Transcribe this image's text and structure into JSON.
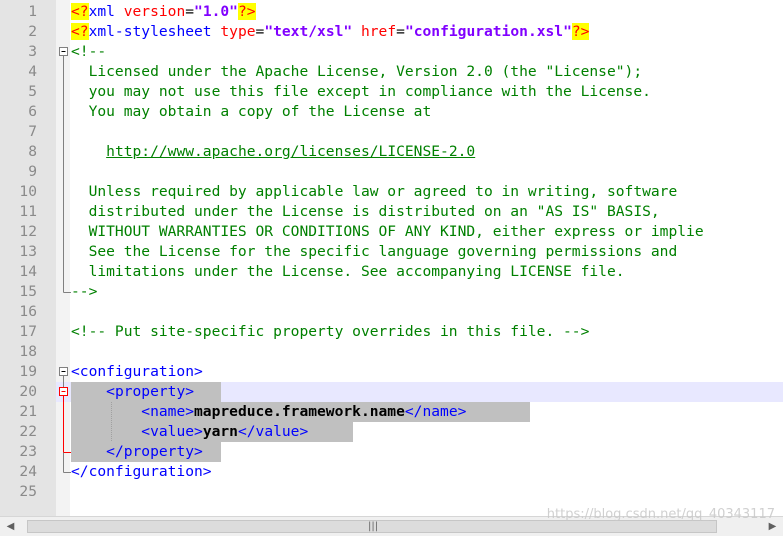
{
  "editor": {
    "line_numbers": [
      "1",
      "2",
      "3",
      "4",
      "5",
      "6",
      "7",
      "8",
      "9",
      "10",
      "11",
      "12",
      "13",
      "14",
      "15",
      "16",
      "17",
      "18",
      "19",
      "20",
      "21",
      "22",
      "23",
      "24",
      "25"
    ],
    "lines": [
      {
        "pi_open": "<?",
        "tag": "xml",
        "attr": " version",
        "eq": "=",
        "val": "\"1.0\"",
        "pi_close": "?>"
      },
      {
        "pi_open": "<?",
        "tag": "xml-stylesheet",
        "attr1": " type",
        "eq1": "=",
        "val1": "\"text/xsl\"",
        "attr2": " href",
        "eq2": "=",
        "val2": "\"configuration.xsl\"",
        "pi_close": "?>"
      },
      {
        "text": "<!--"
      },
      {
        "text": "  Licensed under the Apache License, Version 2.0 (the \"License\");"
      },
      {
        "text": "  you may not use this file except in compliance with the License."
      },
      {
        "text": "  You may obtain a copy of the License at"
      },
      {
        "text": ""
      },
      {
        "indent": "    ",
        "url": "http://www.apache.org/licenses/LICENSE-2.0"
      },
      {
        "text": ""
      },
      {
        "text": "  Unless required by applicable law or agreed to in writing, software"
      },
      {
        "text": "  distributed under the License is distributed on an \"AS IS\" BASIS,"
      },
      {
        "text": "  WITHOUT WARRANTIES OR CONDITIONS OF ANY KIND, either express or implie"
      },
      {
        "text": "  See the License for the specific language governing permissions and"
      },
      {
        "text": "  limitations under the License. See accompanying LICENSE file."
      },
      {
        "text": "-->"
      },
      {
        "text": ""
      },
      {
        "text": "<!-- Put site-specific property overrides in this file. -->"
      },
      {
        "text": ""
      },
      {
        "tag": "<configuration>"
      },
      {
        "indent": "    ",
        "tag": "<property>"
      },
      {
        "indent": "        ",
        "open": "<name>",
        "value": "mapreduce.framework.name",
        "close": "</name>"
      },
      {
        "indent": "        ",
        "open": "<value>",
        "value": "yarn",
        "close": "</value>"
      },
      {
        "indent": "    ",
        "tag": "</property>"
      },
      {
        "tag": "</configuration>"
      },
      {
        "text": ""
      }
    ]
  },
  "scrollbar": {
    "left_arrow": "◀",
    "right_arrow": "▶",
    "grip": "|||"
  },
  "watermark": "https://blog.csdn.net/qq_40343117",
  "colors": {
    "tag": "#0000ff",
    "attr": "#ff0000",
    "value": "#8000ff",
    "comment": "#008000",
    "pi_bg": "#ffff00",
    "selection": "#c0c0c0"
  }
}
